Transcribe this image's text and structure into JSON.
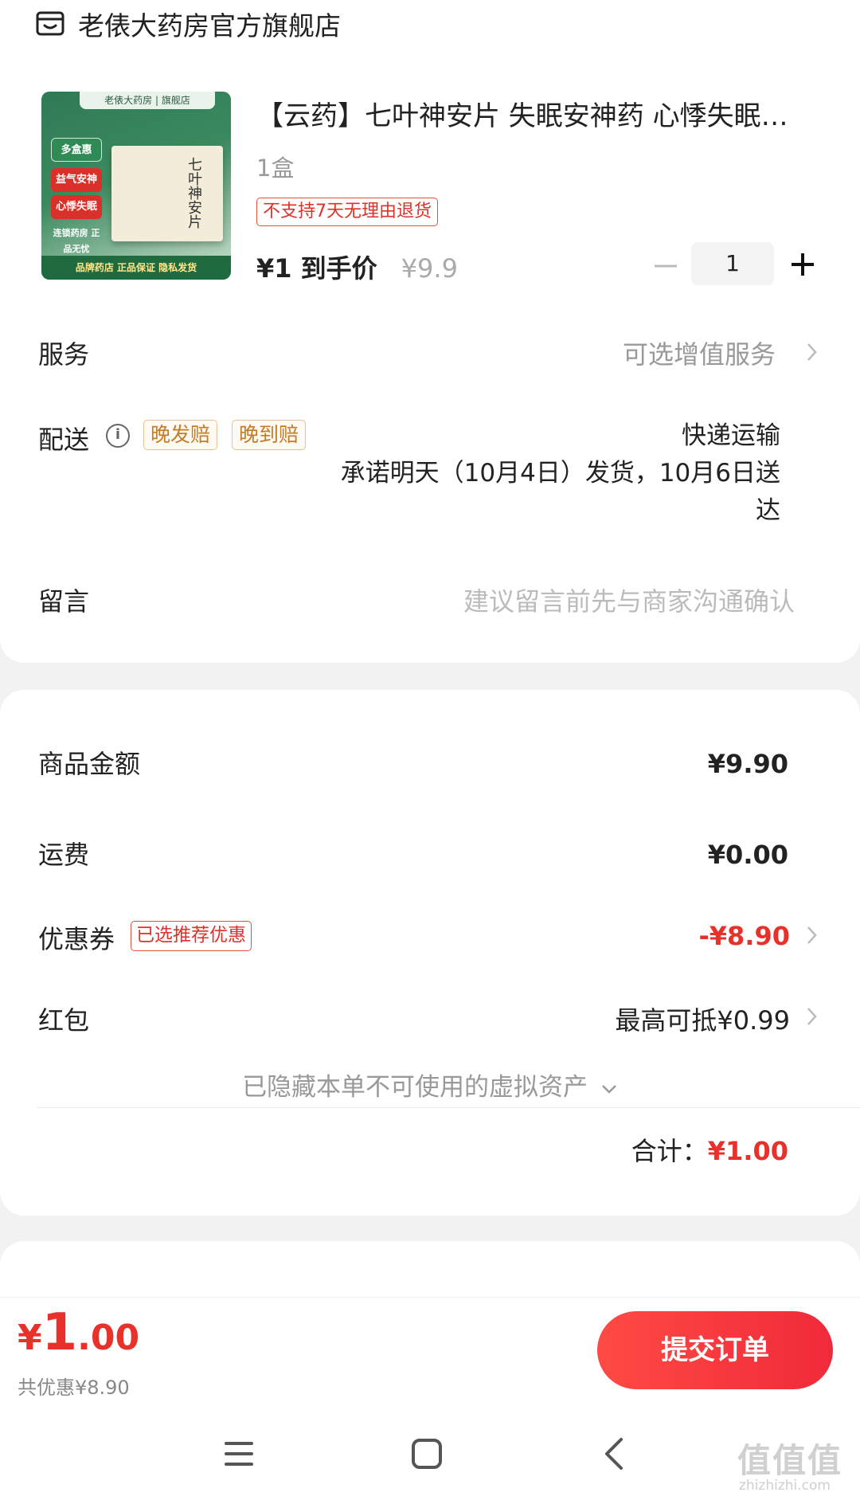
{
  "store": {
    "name": "老俵大药房官方旗舰店",
    "icon": "store-icon"
  },
  "product": {
    "title": "【云药】七叶神安片 失眠安神药 心悸失眠…",
    "spec": "1盒",
    "return_tag": "不支持7天无理由退货",
    "price_label": "¥1 到手价",
    "original_price": "¥9.9",
    "quantity": "1",
    "thumb": {
      "brand": "老俵大药房 | 旗舰店",
      "tag1": "多盒惠",
      "tag2": "益气安神",
      "tag3": "心悸失眠",
      "tag4": "连锁药房 正品无忧",
      "box_title": "七叶神安片",
      "footer": "品牌药店  正品保证  隐私发货"
    }
  },
  "service": {
    "label": "服务",
    "value": "可选增值服务"
  },
  "delivery": {
    "label": "配送",
    "tags": [
      "晚发赔",
      "晚到赔"
    ],
    "method": "快递运输",
    "promise_line1": "承诺明天（10月4日）发货，10月6日送",
    "promise_line2": "达"
  },
  "message": {
    "label": "留言",
    "placeholder": "建议留言前先与商家沟通确认"
  },
  "summary": {
    "goods_label": "商品金额",
    "goods_value": "¥9.90",
    "shipping_label": "运费",
    "shipping_value": "¥0.00",
    "coupon_label": "优惠券",
    "coupon_tag": "已选推荐优惠",
    "coupon_value": "-¥8.90",
    "redpacket_label": "红包",
    "redpacket_value": "最高可抵¥0.99",
    "hidden_assets": "已隐藏本单不可使用的虚拟资产",
    "total_label": "合计：",
    "total_value": "¥1.00"
  },
  "footer": {
    "pay_currency": "¥",
    "pay_int": "1",
    "pay_dec": ".00",
    "discount_text": "共优惠¥8.90",
    "submit_label": "提交订单"
  },
  "watermark": {
    "text": "值值值",
    "url": "zhizhizhi.com"
  },
  "colors": {
    "accent": "#e8312a",
    "tag_gold": "#c47b26"
  }
}
